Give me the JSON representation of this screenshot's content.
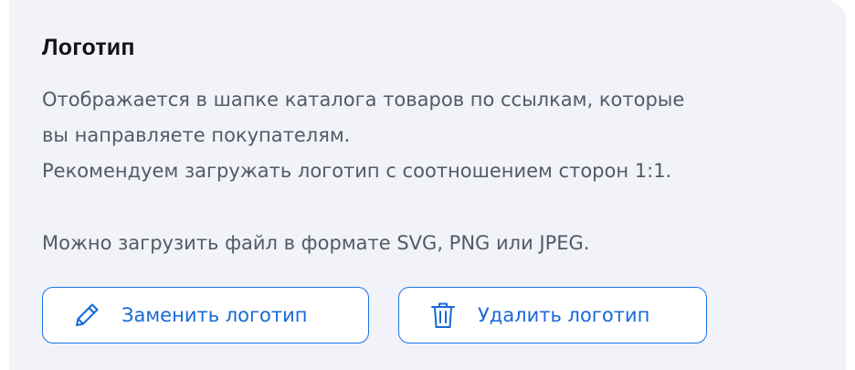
{
  "logo_section": {
    "title": "Логотип",
    "description_lines": [
      "Отображается в шапке каталога товаров по ссылкам, которые",
      "вы направляете покупателям.",
      "Рекомендуем загружать логотип с соотношением сторон 1:1."
    ],
    "formats_text": "Можно загрузить файл в формате SVG, PNG или JPEG.",
    "replace_button": {
      "label": "Заменить логотип",
      "icon": "pencil-icon"
    },
    "delete_button": {
      "label": "Удалить логотип",
      "icon": "trash-icon"
    },
    "accent_color": "#1a73e8",
    "card_background": "#f1f3f9"
  }
}
